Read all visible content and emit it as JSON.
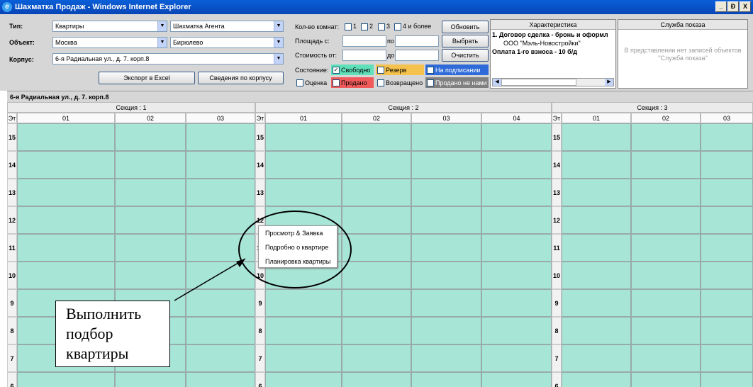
{
  "window": {
    "title": "Шахматка Продаж - Windows Internet Explorer",
    "min": "_",
    "max": "Ð",
    "close": "X"
  },
  "filter": {
    "type_label": "Тип:",
    "type_value": "Квартиры",
    "view_value": "Шахматка Агента",
    "object_label": "Объект:",
    "object_value": "Москва",
    "district_value": "Бирюлево",
    "building_label": "Корпус:",
    "building_value": "6-я Радиальная ул., д. 7. корп.8",
    "export_button": "Экспорт в Excel",
    "building_info_button": "Сведения по корпусу",
    "rooms_label": "Кол-во комнат:",
    "rooms": [
      "1",
      "2",
      "3",
      "4 и более"
    ],
    "area_label": "Площадь с:",
    "area_to": "по",
    "price_label": "Стоимость от:",
    "price_to": "до",
    "refresh_button": "Обновить",
    "select_button": "Выбрать",
    "clear_button": "Очистить",
    "status_label": "Состояние:",
    "states": [
      {
        "label": "Свободно",
        "color": "#5fe0b8",
        "checked": true
      },
      {
        "label": "Резерв",
        "color": "#f5c24d",
        "checked": false
      },
      {
        "label": "На подписании",
        "color": "#2f6bd8",
        "checked": false
      },
      {
        "label": "Оценка",
        "color": "#ffffff",
        "checked": false
      },
      {
        "label": "Продано",
        "color": "#f05a5a",
        "checked": false
      },
      {
        "label": "Возвращено",
        "color": "#ffffff",
        "checked": false
      },
      {
        "label": "Продано не нами",
        "color": "#808080",
        "checked": false
      }
    ]
  },
  "characteristics": {
    "header": "Характеристика",
    "line1": "1. Договор сделка - бронь и оформл",
    "line2": "ООО \"Мэль-Новостройки\"",
    "line3": "Оплата 1-го взноса - 10 б/д"
  },
  "service": {
    "header": "Служба показа",
    "empty_text": "В представлении нет записей объектов \"Служба показа\""
  },
  "grid": {
    "building_title": "6-я Радиальная ул., д. 7. корп.8",
    "floor_label": "Эт",
    "sections": [
      "Секция : 1",
      "Секция : 2",
      "Секция : 3"
    ],
    "columns": [
      "01",
      "02",
      "03",
      "01",
      "02",
      "03",
      "04",
      "01",
      "02",
      "03"
    ],
    "floors": [
      "15",
      "14",
      "13",
      "12",
      "11",
      "10",
      "9",
      "8",
      "7",
      "6"
    ]
  },
  "context_menu": [
    "Просмотр & Заявка",
    "Подробно о квартире",
    "Планировка квартиры"
  ],
  "callout": {
    "text": "Выполнить подбор квартиры"
  }
}
